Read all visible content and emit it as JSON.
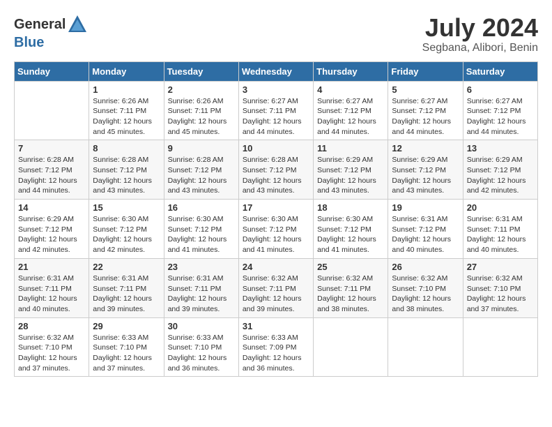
{
  "logo": {
    "general": "General",
    "blue": "Blue"
  },
  "title": {
    "month_year": "July 2024",
    "location": "Segbana, Alibori, Benin"
  },
  "days_header": [
    "Sunday",
    "Monday",
    "Tuesday",
    "Wednesday",
    "Thursday",
    "Friday",
    "Saturday"
  ],
  "weeks": [
    [
      {
        "day": "",
        "sunrise": "",
        "sunset": "",
        "daylight": ""
      },
      {
        "day": "1",
        "sunrise": "Sunrise: 6:26 AM",
        "sunset": "Sunset: 7:11 PM",
        "daylight": "Daylight: 12 hours and 45 minutes."
      },
      {
        "day": "2",
        "sunrise": "Sunrise: 6:26 AM",
        "sunset": "Sunset: 7:11 PM",
        "daylight": "Daylight: 12 hours and 45 minutes."
      },
      {
        "day": "3",
        "sunrise": "Sunrise: 6:27 AM",
        "sunset": "Sunset: 7:11 PM",
        "daylight": "Daylight: 12 hours and 44 minutes."
      },
      {
        "day": "4",
        "sunrise": "Sunrise: 6:27 AM",
        "sunset": "Sunset: 7:12 PM",
        "daylight": "Daylight: 12 hours and 44 minutes."
      },
      {
        "day": "5",
        "sunrise": "Sunrise: 6:27 AM",
        "sunset": "Sunset: 7:12 PM",
        "daylight": "Daylight: 12 hours and 44 minutes."
      },
      {
        "day": "6",
        "sunrise": "Sunrise: 6:27 AM",
        "sunset": "Sunset: 7:12 PM",
        "daylight": "Daylight: 12 hours and 44 minutes."
      }
    ],
    [
      {
        "day": "7",
        "sunrise": "Sunrise: 6:28 AM",
        "sunset": "Sunset: 7:12 PM",
        "daylight": "Daylight: 12 hours and 44 minutes."
      },
      {
        "day": "8",
        "sunrise": "Sunrise: 6:28 AM",
        "sunset": "Sunset: 7:12 PM",
        "daylight": "Daylight: 12 hours and 43 minutes."
      },
      {
        "day": "9",
        "sunrise": "Sunrise: 6:28 AM",
        "sunset": "Sunset: 7:12 PM",
        "daylight": "Daylight: 12 hours and 43 minutes."
      },
      {
        "day": "10",
        "sunrise": "Sunrise: 6:28 AM",
        "sunset": "Sunset: 7:12 PM",
        "daylight": "Daylight: 12 hours and 43 minutes."
      },
      {
        "day": "11",
        "sunrise": "Sunrise: 6:29 AM",
        "sunset": "Sunset: 7:12 PM",
        "daylight": "Daylight: 12 hours and 43 minutes."
      },
      {
        "day": "12",
        "sunrise": "Sunrise: 6:29 AM",
        "sunset": "Sunset: 7:12 PM",
        "daylight": "Daylight: 12 hours and 43 minutes."
      },
      {
        "day": "13",
        "sunrise": "Sunrise: 6:29 AM",
        "sunset": "Sunset: 7:12 PM",
        "daylight": "Daylight: 12 hours and 42 minutes."
      }
    ],
    [
      {
        "day": "14",
        "sunrise": "Sunrise: 6:29 AM",
        "sunset": "Sunset: 7:12 PM",
        "daylight": "Daylight: 12 hours and 42 minutes."
      },
      {
        "day": "15",
        "sunrise": "Sunrise: 6:30 AM",
        "sunset": "Sunset: 7:12 PM",
        "daylight": "Daylight: 12 hours and 42 minutes."
      },
      {
        "day": "16",
        "sunrise": "Sunrise: 6:30 AM",
        "sunset": "Sunset: 7:12 PM",
        "daylight": "Daylight: 12 hours and 41 minutes."
      },
      {
        "day": "17",
        "sunrise": "Sunrise: 6:30 AM",
        "sunset": "Sunset: 7:12 PM",
        "daylight": "Daylight: 12 hours and 41 minutes."
      },
      {
        "day": "18",
        "sunrise": "Sunrise: 6:30 AM",
        "sunset": "Sunset: 7:12 PM",
        "daylight": "Daylight: 12 hours and 41 minutes."
      },
      {
        "day": "19",
        "sunrise": "Sunrise: 6:31 AM",
        "sunset": "Sunset: 7:12 PM",
        "daylight": "Daylight: 12 hours and 40 minutes."
      },
      {
        "day": "20",
        "sunrise": "Sunrise: 6:31 AM",
        "sunset": "Sunset: 7:11 PM",
        "daylight": "Daylight: 12 hours and 40 minutes."
      }
    ],
    [
      {
        "day": "21",
        "sunrise": "Sunrise: 6:31 AM",
        "sunset": "Sunset: 7:11 PM",
        "daylight": "Daylight: 12 hours and 40 minutes."
      },
      {
        "day": "22",
        "sunrise": "Sunrise: 6:31 AM",
        "sunset": "Sunset: 7:11 PM",
        "daylight": "Daylight: 12 hours and 39 minutes."
      },
      {
        "day": "23",
        "sunrise": "Sunrise: 6:31 AM",
        "sunset": "Sunset: 7:11 PM",
        "daylight": "Daylight: 12 hours and 39 minutes."
      },
      {
        "day": "24",
        "sunrise": "Sunrise: 6:32 AM",
        "sunset": "Sunset: 7:11 PM",
        "daylight": "Daylight: 12 hours and 39 minutes."
      },
      {
        "day": "25",
        "sunrise": "Sunrise: 6:32 AM",
        "sunset": "Sunset: 7:11 PM",
        "daylight": "Daylight: 12 hours and 38 minutes."
      },
      {
        "day": "26",
        "sunrise": "Sunrise: 6:32 AM",
        "sunset": "Sunset: 7:10 PM",
        "daylight": "Daylight: 12 hours and 38 minutes."
      },
      {
        "day": "27",
        "sunrise": "Sunrise: 6:32 AM",
        "sunset": "Sunset: 7:10 PM",
        "daylight": "Daylight: 12 hours and 37 minutes."
      }
    ],
    [
      {
        "day": "28",
        "sunrise": "Sunrise: 6:32 AM",
        "sunset": "Sunset: 7:10 PM",
        "daylight": "Daylight: 12 hours and 37 minutes."
      },
      {
        "day": "29",
        "sunrise": "Sunrise: 6:33 AM",
        "sunset": "Sunset: 7:10 PM",
        "daylight": "Daylight: 12 hours and 37 minutes."
      },
      {
        "day": "30",
        "sunrise": "Sunrise: 6:33 AM",
        "sunset": "Sunset: 7:10 PM",
        "daylight": "Daylight: 12 hours and 36 minutes."
      },
      {
        "day": "31",
        "sunrise": "Sunrise: 6:33 AM",
        "sunset": "Sunset: 7:09 PM",
        "daylight": "Daylight: 12 hours and 36 minutes."
      },
      {
        "day": "",
        "sunrise": "",
        "sunset": "",
        "daylight": ""
      },
      {
        "day": "",
        "sunrise": "",
        "sunset": "",
        "daylight": ""
      },
      {
        "day": "",
        "sunrise": "",
        "sunset": "",
        "daylight": ""
      }
    ]
  ]
}
